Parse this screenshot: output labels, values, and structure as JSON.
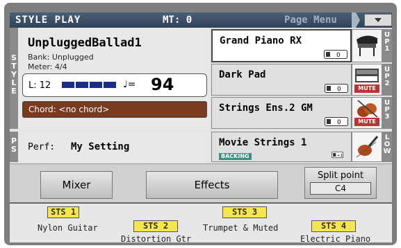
{
  "header": {
    "title": "STYLE PLAY",
    "mt": "MT: 0",
    "page_menu": "Page Menu"
  },
  "style_panel": {
    "side_tab": [
      "S",
      "T",
      "Y",
      "L",
      "E"
    ],
    "name": "UnpluggedBallad1",
    "bank": "Bank:  Unplugged",
    "meter": "Meter:  4/4",
    "level_label": "L: 12",
    "tempo_sign": "♩=",
    "tempo": "94",
    "chord": "Chord: <no chord>"
  },
  "perf_panel": {
    "side_tab": [
      "P",
      "S"
    ],
    "label": "Perf:",
    "value": "My Setting"
  },
  "tracks": [
    {
      "name": "Grand Piano RX",
      "octave": "0",
      "icon": "grand-piano-icon",
      "tab": [
        "U",
        "P",
        "1"
      ],
      "mute": ""
    },
    {
      "name": "Dark Pad",
      "octave": "0",
      "icon": "synth-pad-icon",
      "tab": [
        "U",
        "P",
        "2"
      ],
      "mute": "MUTE"
    },
    {
      "name": "Strings Ens.2 GM",
      "octave": "0",
      "icon": "strings-icon",
      "tab": [
        "U",
        "P",
        "3"
      ],
      "mute": "MUTE"
    },
    {
      "name": "Movie Strings 1",
      "octave": "+1",
      "icon": "violin-icon",
      "tab": [
        "L",
        "O",
        "W"
      ],
      "mute": "",
      "badge": "BACKING"
    }
  ],
  "buttons": {
    "mixer": "Mixer",
    "effects": "Effects",
    "split_point": "Split point",
    "split_value": "C4"
  },
  "sts": [
    {
      "tag": "STS 1",
      "label": "Nylon Guitar"
    },
    {
      "tag": "STS 2",
      "label": "Distortion Gtr"
    },
    {
      "tag": "STS 3",
      "label": "Trumpet & Muted"
    },
    {
      "tag": "STS 4",
      "label": "Electric Piano"
    }
  ],
  "colors": {
    "header": "#3b5068",
    "chord_bar": "#7a3a20",
    "sts_button": "#f4e64c",
    "mute": "#b33333"
  }
}
